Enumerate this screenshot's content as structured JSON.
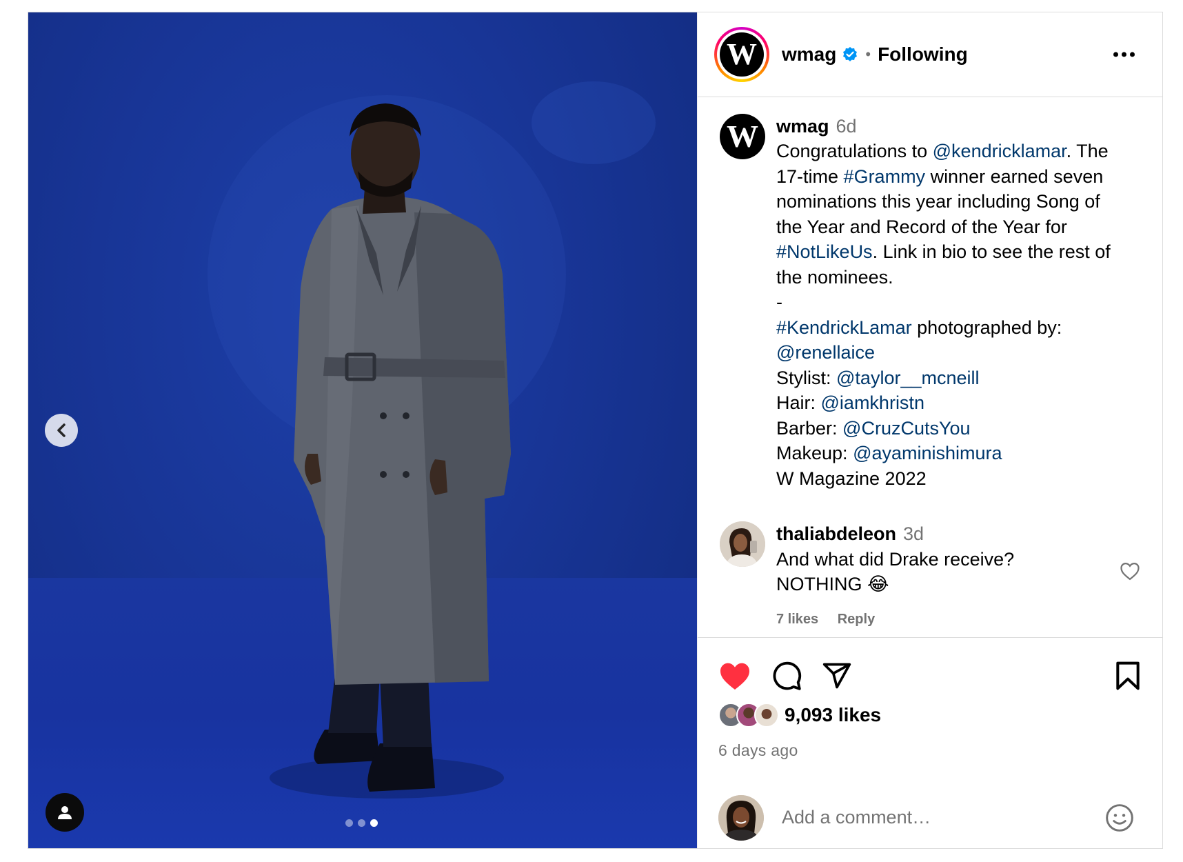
{
  "post": {
    "media": {
      "carousel": {
        "total": 3,
        "active_index": 2
      },
      "icons": {
        "prev": "chevron-left-icon",
        "tagged": "user-tag-icon"
      }
    },
    "header": {
      "username": "wmag",
      "avatar_letter": "W",
      "separator": "•",
      "follow_status": "Following",
      "verified": true
    },
    "caption": {
      "username": "wmag",
      "time": "6d",
      "avatar_letter": "W",
      "lines": [
        [
          {
            "t": "Congratulations to "
          },
          {
            "t": "@kendricklamar",
            "link": true
          },
          {
            "t": ". The"
          }
        ],
        [
          {
            "t": "17-time "
          },
          {
            "t": "#Grammy",
            "link": true
          },
          {
            "t": " winner earned seven"
          }
        ],
        [
          {
            "t": "nominations this year including Song of"
          }
        ],
        [
          {
            "t": "the Year and Record of the Year for"
          }
        ],
        [
          {
            "t": "#NotLikeUs",
            "link": true
          },
          {
            "t": ". Link in bio to see the rest of"
          }
        ],
        [
          {
            "t": "the nominees."
          }
        ],
        [
          {
            "t": "-"
          }
        ],
        [
          {
            "t": "#KendrickLamar",
            "link": true
          },
          {
            "t": " photographed by:"
          }
        ],
        [
          {
            "t": "@renellaice",
            "link": true
          }
        ],
        [
          {
            "t": "Stylist: "
          },
          {
            "t": "@taylor__mcneill",
            "link": true
          }
        ],
        [
          {
            "t": "Hair: "
          },
          {
            "t": "@iamkhristn",
            "link": true
          }
        ],
        [
          {
            "t": "Barber: "
          },
          {
            "t": "@CruzCutsYou",
            "link": true
          }
        ],
        [
          {
            "t": "Makeup: "
          },
          {
            "t": "@ayaminishimura",
            "link": true
          }
        ],
        [
          {
            "t": "W Magazine 2022"
          }
        ]
      ]
    },
    "comments": [
      {
        "username": "thaliabdeleon",
        "time": "3d",
        "lines": [
          "And what did Drake receive?",
          "NOTHING 😂"
        ],
        "likes": "7 likes",
        "reply": "Reply"
      }
    ],
    "actions": {
      "liked": true,
      "like_color": "#ff3040",
      "icons": [
        "heart-icon",
        "comment-icon",
        "share-icon",
        "bookmark-icon"
      ]
    },
    "likes_text": "9,093 likes",
    "posted": "6 days ago",
    "add_comment": {
      "placeholder": "Add a comment…"
    }
  }
}
